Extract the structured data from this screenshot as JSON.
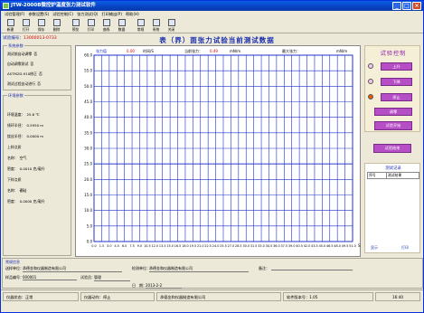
{
  "window": {
    "title": "JTW-2000B微控炉温度张力测试软件",
    "min": "_",
    "max": "□",
    "close": "×"
  },
  "menu": [
    "试验管理(F)",
    "参数设置(S)",
    "试验控制(C)",
    "张力测试(Q)",
    "打印输出(P)",
    "帮助(H)"
  ],
  "toolbar": [
    {
      "label": "新建",
      "icon": "new-file-icon"
    },
    {
      "label": "打开",
      "icon": "open-folder-icon"
    },
    {
      "label": "保存",
      "icon": "save-icon"
    },
    {
      "label": "删除",
      "icon": "delete-icon"
    },
    {
      "label": "预览",
      "icon": "preview-icon"
    },
    {
      "label": "打印",
      "icon": "printer-icon"
    },
    {
      "label": "曲线",
      "icon": "curve-icon"
    },
    {
      "label": "数据",
      "icon": "data-icon"
    },
    {
      "label": "常规",
      "icon": "tools-icon"
    },
    {
      "label": "系统",
      "icon": "search-icon"
    },
    {
      "label": "关闭",
      "icon": "close-doc-icon"
    }
  ],
  "left": {
    "sample_label": "试验编号：",
    "sample_no": "13000013-0733",
    "system_group": "系统参数",
    "system_rows": [
      {
        "label": "测试前自动调零",
        "value": "否"
      },
      {
        "label": "自动调零测试",
        "value": "否"
      },
      {
        "label": "ASTM2D-910修正",
        "value": "否"
      },
      {
        "label": "测试过程自动进行",
        "value": "否"
      }
    ],
    "env_group": "环境参数",
    "env_rows": [
      {
        "label": "环境温度：",
        "value": "25.6 ℃"
      },
      {
        "label": "线环半径：",
        "value": "0.5950 m"
      },
      {
        "label": "绕丝半径：",
        "value": "0.0000 m"
      },
      {
        "label": "上样点质",
        "value": ""
      },
      {
        "label": "名称：",
        "value": "空气"
      },
      {
        "label": "密度：",
        "value": "0.0010 克/毫升"
      },
      {
        "label": "下样点质",
        "value": ""
      },
      {
        "label": "名称：",
        "value": "硼硅"
      },
      {
        "label": "密度：",
        "value": "0.0000 克/毫升"
      }
    ]
  },
  "chart": {
    "heading": "表（界）面张力试验当前测试数据",
    "hdr_time": "时间/S",
    "hdr_cur_label": "当前张力：",
    "hdr_cur_val": "0.49",
    "hdr_unit1": "mN/m",
    "hdr_max_label": "最大张力：",
    "hdr_unit2": "mN/m",
    "hdr_left": "最大张力",
    "hdr_left_val": "0.00",
    "hdr_left_unit": "mN/m",
    "hdr_left2": "张力值",
    "x_unit": "S"
  },
  "chart_data": {
    "type": "line",
    "title": "表（界）面张力试验当前测试数据",
    "xlabel": "",
    "ylabel": "",
    "xlim": [
      0,
      50
    ],
    "ylim": [
      0,
      60
    ],
    "x_ticks": [
      0.0,
      1.5,
      3.0,
      4.5,
      6.0,
      7.5,
      9.0,
      10.5,
      12.0,
      13.5,
      15.0,
      16.5,
      18.0,
      19.5,
      21.0,
      22.5,
      24.0,
      25.5,
      27.0,
      28.5,
      30.0,
      31.5,
      33.0,
      34.5,
      36.0,
      37.5,
      39.0,
      40.5,
      42.0,
      43.5,
      45.0,
      46.5,
      48.0,
      49.5,
      51.0
    ],
    "y_ticks": [
      0.0,
      5.0,
      10.0,
      15.0,
      20.0,
      25.0,
      30.0,
      35.0,
      40.0,
      45.0,
      50.0,
      55.0,
      60.0
    ],
    "grid": true,
    "series": [
      {
        "values": [
          [
            0,
            25.0
          ],
          [
            50,
            25.0
          ]
        ]
      }
    ],
    "colors": {
      "grid": "#1e32c8",
      "line": "#1e32c8"
    }
  },
  "right": {
    "ctrl_title": "试验控制",
    "up": "上升",
    "down": "下降",
    "stop": "停止",
    "zero": "调零",
    "start": "试验开始",
    "result": "试验结束",
    "rec_title": "测试记录",
    "rec_cols": [
      "序号",
      "测试结果"
    ],
    "rec_foot1": "显示",
    "rec_foot2": "打印"
  },
  "info": {
    "title": "常规信息",
    "unit_label": "送样单位：",
    "unit_val": "承德金和仪器制造有限公司",
    "test_unit_label": "检测单位：",
    "test_unit_val": "承德金和仪器制造有限公司",
    "remark_label": "备注：",
    "sample_label": "样品编号：",
    "sample_val": "000001",
    "person_label": "试验员：",
    "person_val": "管理",
    "date_label": "日　期：",
    "date_val": "2013-2-2"
  },
  "status": {
    "state": "仪器状态：正常",
    "action": "仪器动作：停止",
    "company": "承德金和仪器制造有限公司",
    "version": "软件版本号：1.05",
    "time": "16:40"
  }
}
